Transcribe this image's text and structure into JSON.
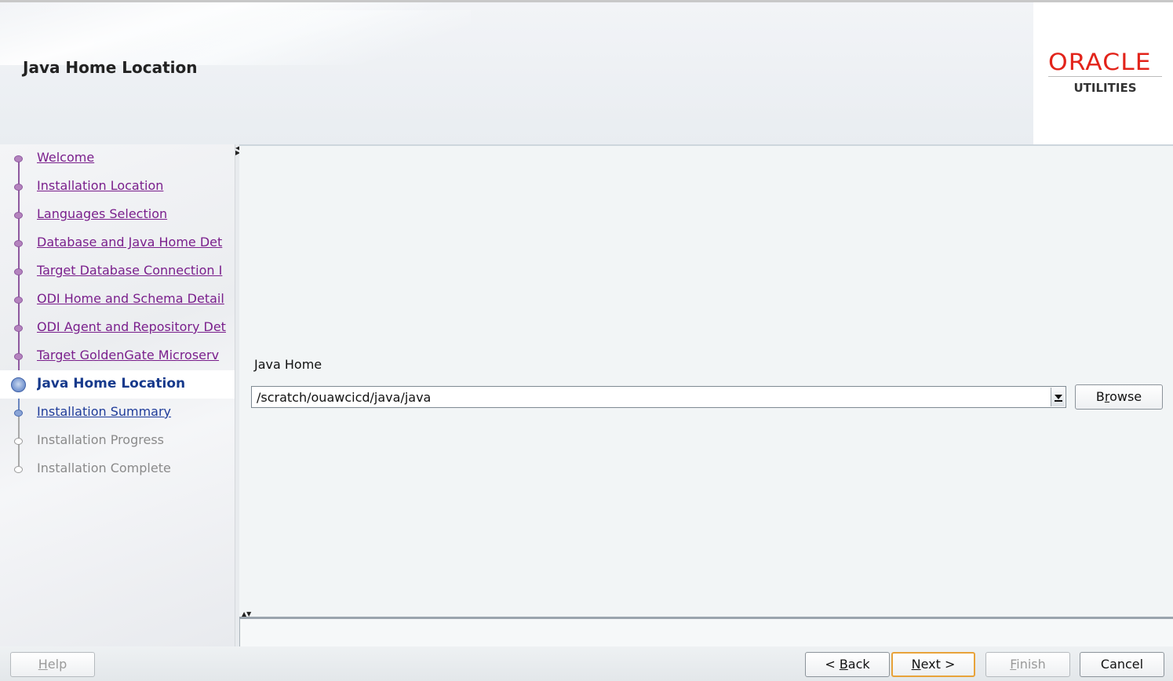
{
  "header": {
    "title": "Java Home Location",
    "logo_brand": "ORACLE",
    "logo_sub": "UTILITIES",
    "brand_color": "#e2231a"
  },
  "sidebar": {
    "steps": [
      {
        "label": "Welcome",
        "state": "visited"
      },
      {
        "label": "Installation Location",
        "state": "visited"
      },
      {
        "label": "Languages Selection",
        "state": "visited"
      },
      {
        "label": "Database and Java Home Det",
        "state": "visited"
      },
      {
        "label": "Target Database Connection I",
        "state": "visited"
      },
      {
        "label": "ODI Home and Schema Detail",
        "state": "visited"
      },
      {
        "label": "ODI Agent and Repository Det",
        "state": "visited"
      },
      {
        "label": "Target GoldenGate Microserv",
        "state": "visited"
      },
      {
        "label": "Java Home Location",
        "state": "current"
      },
      {
        "label": "Installation Summary",
        "state": "next"
      },
      {
        "label": "Installation Progress",
        "state": "disabled"
      },
      {
        "label": "Installation Complete",
        "state": "disabled"
      }
    ]
  },
  "main": {
    "java_home_label": "Java Home",
    "java_home_value": "/scratch/ouawcicd/java/java",
    "browse_label_pre": "B",
    "browse_label_mn": "r",
    "browse_label_post": "owse"
  },
  "footer": {
    "help_mn": "H",
    "help_rest": "elp",
    "back_pre": "< ",
    "back_mn": "B",
    "back_rest": "ack",
    "next_mn": "N",
    "next_rest": "ext >",
    "finish_mn": "F",
    "finish_rest": "inish",
    "cancel_label": "Cancel"
  }
}
